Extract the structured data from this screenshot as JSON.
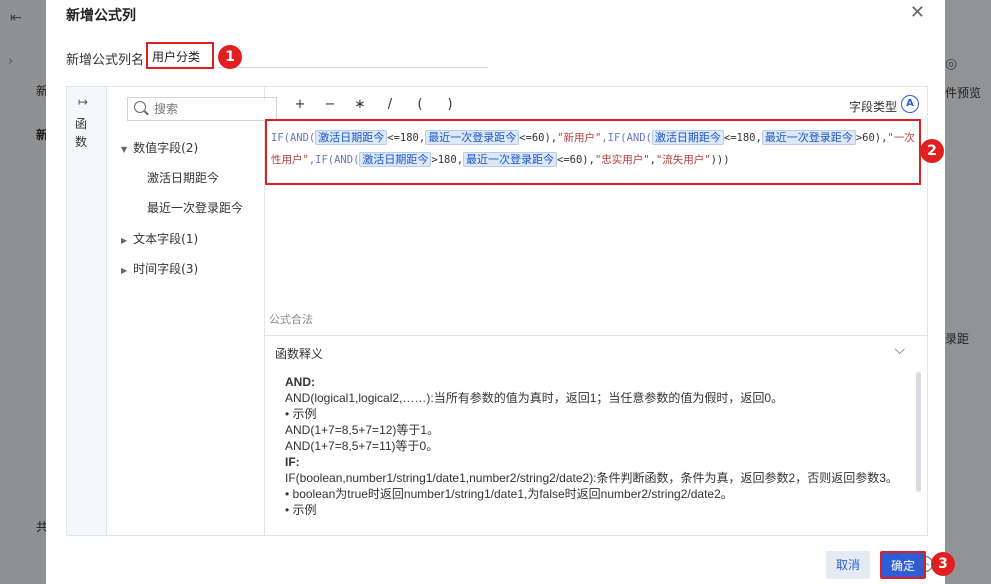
{
  "background": {
    "left_t1": "新",
    "left_t2": "新",
    "left_t3": "共",
    "right_preview": "件预览",
    "right_juli": "录距"
  },
  "dialog": {
    "title": "新增公式列",
    "name_label": "新增公式列名",
    "name_value": "用户分类",
    "func_tab_label": "函数",
    "search_placeholder": "搜索",
    "tree": {
      "numeric_group": "数值字段(2)",
      "numeric_items": [
        "激活日期距今",
        "最近一次登录距今"
      ],
      "text_group": "文本字段(1)",
      "time_group": "时间字段(3)"
    },
    "operators": [
      "+",
      "−",
      "∗",
      "/",
      "(",
      ")"
    ],
    "field_type_label": "字段类型",
    "formula": {
      "seg1": "IF(AND(",
      "f1": "激活日期距今",
      "seg2": "<=180,",
      "f2": "最近一次登录距今",
      "seg3": "<=60),",
      "s1": "\"新用户\"",
      "seg4": ",IF(AND(",
      "f3": "激活日期距今",
      "seg5": "<=180,",
      "f4": "最近一次登录距今",
      "seg6": ">60),",
      "s2": "\"一次性用户\"",
      "seg7": ",IF(AND(",
      "f5": "激活日期距今",
      "seg8": ">180,",
      "f6": "最近一次登录距今",
      "seg9": "<=60),",
      "s3": "\"忠实用户\"",
      "seg10": ",",
      "s4": "\"流失用户\"",
      "seg11": ")))"
    },
    "valid_label": "公式合法",
    "explain_title": "函数释义",
    "explain_lines": [
      "AND:",
      "AND(logical1,logical2,……):当所有参数的值为真时，返回1；当任意参数的值为假时，返回0。",
      "• 示例",
      "AND(1+7=8,5+7=12)等于1。",
      "AND(1+7=8,5+7=11)等于0。",
      "IF:",
      "IF(boolean,number1/string1/date1,number2/string2/date2):条件判断函数，条件为真，返回参数2，否则返回参数3。",
      "• boolean为true时返回number1/string1/date1,为false时返回number2/string2/date2。",
      "• 示例"
    ],
    "cancel_label": "取消",
    "ok_label": "确定"
  },
  "annotations": [
    "1",
    "2",
    "3"
  ],
  "colors": {
    "accent": "#2f5cd8",
    "highlight_red": "#e02020"
  }
}
